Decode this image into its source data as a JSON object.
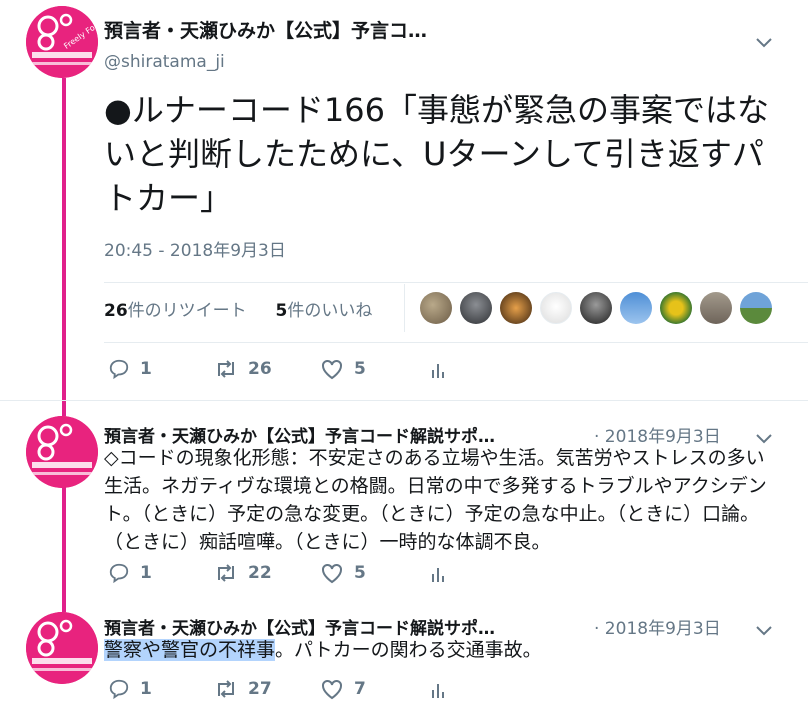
{
  "account": {
    "name": "預言者・天瀬ひみか【公式】予言コ…",
    "handle": "@shiratama_ji",
    "avatar_text": "Freely Forever"
  },
  "main_tweet": {
    "text": "●ルナーコード166「事態が緊急の事案ではないと判断したために、Uターンして引き返すパトカー」",
    "timestamp": "20:45 - 2018年9月3日",
    "retweets_num": "26",
    "retweets_label": "件のリツイート",
    "likes_num": "5",
    "likes_label": "件のいいね",
    "reply_count": "1",
    "retweet_count": "26",
    "like_count": "5"
  },
  "replies": [
    {
      "name": "預言者・天瀬ひみか【公式】予言コード解説サポ…",
      "date": "· 2018年9月3日",
      "text": "◇コードの現象化形態：不安定さのある立場や生活。気苦労やストレスの多い生活。ネガティヴな環境との格闘。日常の中で多発するトラブルやアクシデント。（ときに）予定の急な変更。（ときに）予定の急な中止。（ときに）口論。（ときに）痴話喧嘩。（ときに）一時的な体調不良。",
      "reply_count": "1",
      "retweet_count": "22",
      "like_count": "5"
    },
    {
      "name": "預言者・天瀬ひみか【公式】予言コード解説サポ…",
      "date": "· 2018年9月3日",
      "text_highlight": "警察や警官の不祥事",
      "text_rest": "。パトカーの関わる交通事故。",
      "reply_count": "1",
      "retweet_count": "27",
      "like_count": "7"
    }
  ],
  "colors": {
    "brand_pink": "#e8237e",
    "muted": "#657786",
    "text": "#14171a",
    "highlight": "#b3d4fd"
  }
}
